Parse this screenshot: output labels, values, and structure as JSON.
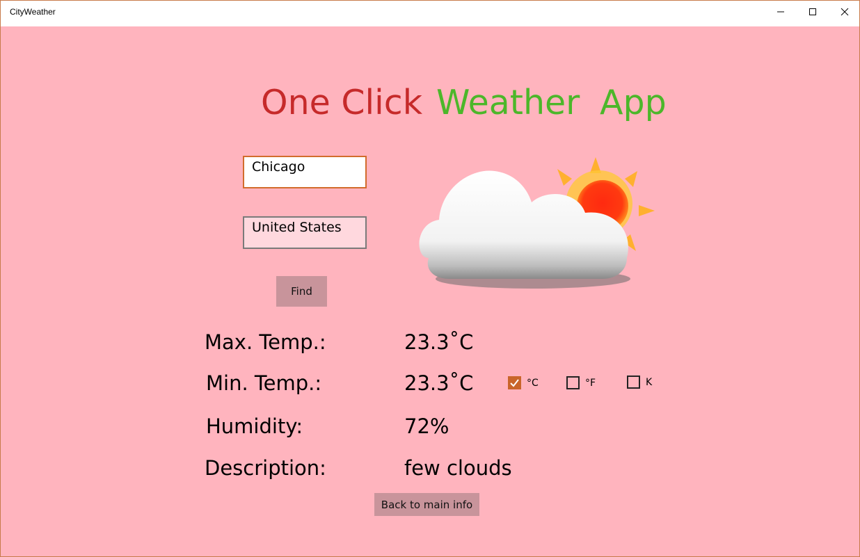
{
  "window": {
    "title": "CityWeather",
    "controls": {
      "minimize": "minimize-icon",
      "maximize": "maximize-icon",
      "close": "close-icon"
    }
  },
  "heading": {
    "word1": "One Click",
    "word2": "Weather",
    "word3": "App",
    "color1": "#c62a2a",
    "color2": "#4cb72a"
  },
  "search": {
    "city_value": "Chicago",
    "country_value": "United States",
    "find_label": "Find"
  },
  "weather_icon": "partly-cloudy-icon",
  "details": {
    "max_temp_label": "Max. Temp.:",
    "max_temp_value": "23.3˚C",
    "min_temp_label": "Min. Temp.:",
    "min_temp_value": "23.3˚C",
    "humidity_label": "Humidity:",
    "humidity_value": "72%",
    "description_label": "Description:",
    "description_value": "few clouds"
  },
  "units": {
    "celsius_label": "°C",
    "fahrenheit_label": "°F",
    "kelvin_label": "K",
    "selected": "°C"
  },
  "back_button_label": "Back to main info",
  "colors": {
    "background": "#ffb4be",
    "accent": "#c9652a",
    "button": "#c8949b"
  }
}
